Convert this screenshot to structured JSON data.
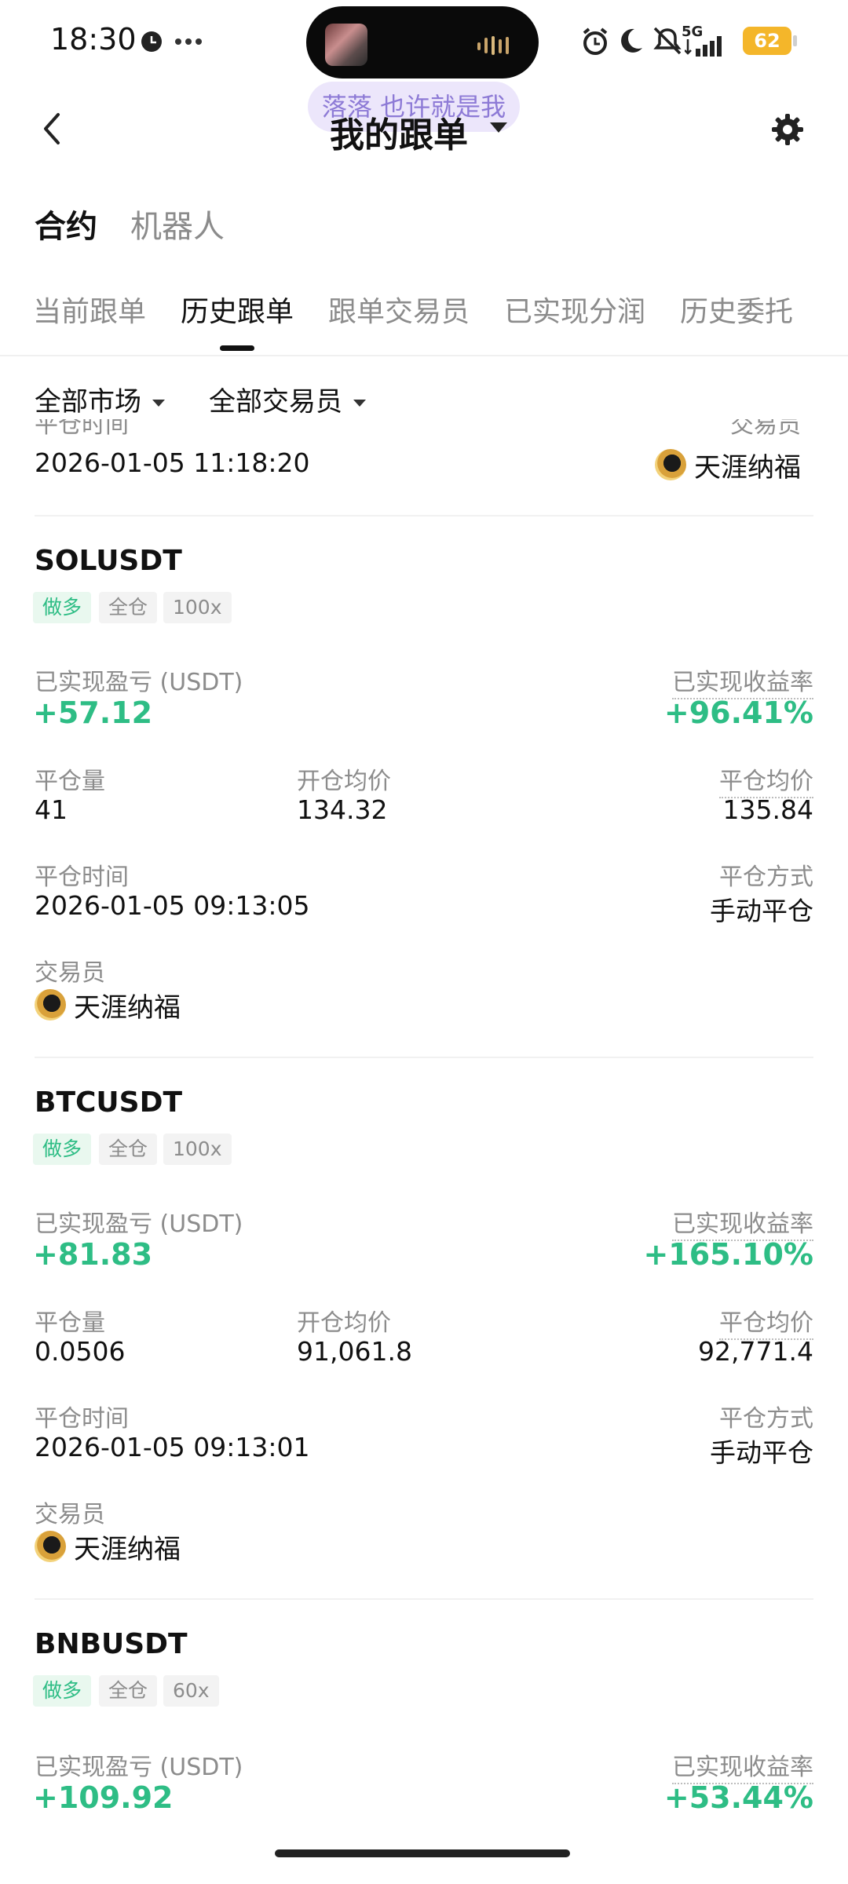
{
  "status_bar": {
    "time": "18:30",
    "network": "5G",
    "battery": "62"
  },
  "header": {
    "lyric": "落落 也许就是我",
    "title": "我的跟单"
  },
  "main_tabs": [
    "合约",
    "机器人"
  ],
  "sub_tabs": [
    "当前跟单",
    "历史跟单",
    "跟单交易员",
    "已实现分润",
    "历史委托"
  ],
  "filters": {
    "market": "全部市场",
    "trader": "全部交易员"
  },
  "partial_top": {
    "time_label": "平仓时间",
    "time": "2026-01-05 11:18:20",
    "trader_label": "交易员",
    "trader": "天涯纳福"
  },
  "labels": {
    "pnl": "已实现盈亏 (USDT)",
    "roi": "已实现收益率",
    "close_qty": "平仓量",
    "open_avg": "开仓均价",
    "close_avg": "平仓均价",
    "close_time": "平仓时间",
    "close_method": "平仓方式",
    "trader": "交易员"
  },
  "tags": {
    "long": "做多",
    "cross": "全仓"
  },
  "orders": [
    {
      "symbol": "SOLUSDT",
      "leverage": "100x",
      "pnl": "+57.12",
      "roi": "+96.41%",
      "close_qty": "41",
      "open_avg": "134.32",
      "close_avg": "135.84",
      "close_time": "2026-01-05 09:13:05",
      "close_method": "手动平仓",
      "trader": "天涯纳福"
    },
    {
      "symbol": "BTCUSDT",
      "leverage": "100x",
      "pnl": "+81.83",
      "roi": "+165.10%",
      "close_qty": "0.0506",
      "open_avg": "91,061.8",
      "close_avg": "92,771.4",
      "close_time": "2026-01-05 09:13:01",
      "close_method": "手动平仓",
      "trader": "天涯纳福"
    },
    {
      "symbol": "BNBUSDT",
      "leverage": "60x",
      "pnl": "+109.92",
      "roi": "+53.44%"
    }
  ],
  "colors": {
    "profit": "#2ebd85",
    "accent_text": "#111111",
    "muted": "#8c8c8c"
  }
}
